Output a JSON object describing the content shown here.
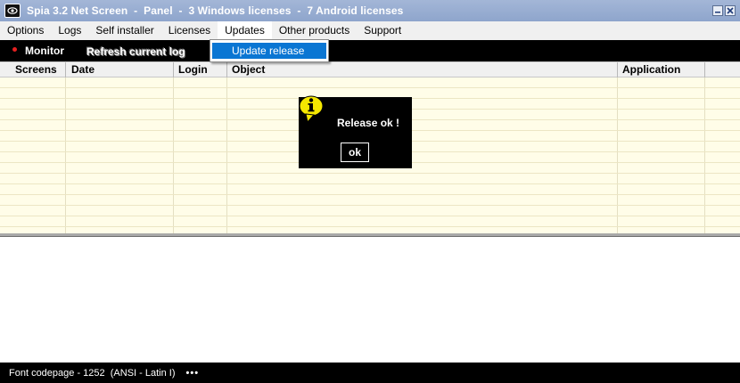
{
  "window": {
    "title": "Spia 3.2 Net Screen  -  Panel  -  3 Windows licenses  -  7 Android licenses"
  },
  "menu": {
    "items": [
      "Options",
      "Logs",
      "Self installer",
      "Licenses",
      "Updates",
      "Other products",
      "Support"
    ]
  },
  "toolbar": {
    "monitor_label": "Monitor",
    "refresh_label": "Refresh current log"
  },
  "updates_menu": {
    "items": [
      "Update release"
    ]
  },
  "grid": {
    "columns": [
      "Screens",
      "Date",
      "Login",
      "Object",
      "Application"
    ]
  },
  "dialog": {
    "message": "Release ok !",
    "ok_label": "ok",
    "icon": "info-icon"
  },
  "status": {
    "text": "Font codepage - 1252  (ANSI - Latin I)",
    "more": "•••"
  },
  "colors": {
    "titlebar": "#9aafd3",
    "grid_background": "#fffde8",
    "highlight": "#0a76d3",
    "info_icon": "#f5e800"
  }
}
